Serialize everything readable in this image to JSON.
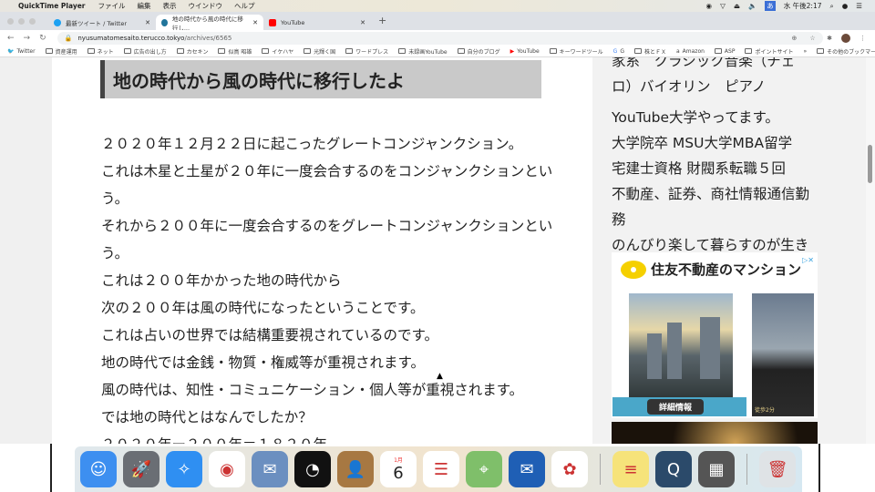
{
  "menubar": {
    "app": "QuickTime Player",
    "items": [
      "ファイル",
      "編集",
      "表示",
      "ウインドウ",
      "ヘルプ"
    ],
    "clock": "水 午後2:17",
    "input_mode": "あ"
  },
  "tabs": [
    {
      "title": "最新ツイート / Twitter",
      "color": "#1da1f2"
    },
    {
      "title": "地の時代から風の時代に移行し...",
      "color": "#21759b",
      "active": true
    },
    {
      "title": "YouTube",
      "color": "#ff0000"
    }
  ],
  "address": {
    "host": "nyusumatomesaito.terucco.tokyo",
    "path": "/archives/6565"
  },
  "bookmarks": [
    "Twitter",
    "資産運用",
    "ネット",
    "広告の出し方",
    "カセキン",
    "似鳥 昭雄",
    "イケハヤ",
    "光輝く国",
    "ワードプレス",
    "未録画YouTube",
    "自分のブログ",
    "YouTube",
    "キーワードツール",
    "G",
    "株とＦＸ",
    "Amazon",
    "ASP",
    "ポイントサイト"
  ],
  "bookmarks_more": "»",
  "bookmarks_other": "その他のブックマーク",
  "article": {
    "heading": "地の時代から風の時代に移行したよ",
    "lines": [
      "２０２０年１２月２２日に起こったグレートコンジャンクション。",
      "これは木星と土星が２０年に一度会合するのをコンジャンクションとい",
      "う。",
      "それから２００年に一度会合するのをグレートコンジャンクションとい",
      "う。",
      "これは２００年かかった地の時代から",
      "次の２００年は風の時代になったということです。",
      "これは占いの世界では結構重要視されているのです。",
      "地の時代では金銭・物質・権威等が重視されます。",
      "風の時代は、知性・コミュニケーション・個人等が重視されます。",
      "では地の時代とはなんでしたか？",
      "２０２０年ー２００年＝１８２０年"
    ]
  },
  "sidebar": {
    "profile_lines": [
      "家系　クラシック音楽（チェ",
      "ロ）バイオリン　ピアノ",
      "YouTube大学やってます。",
      "大学院卒 MSU大学MBA留学",
      "宅建士資格 財閥系転職５回",
      "不動産、証券、商社情報通信勤務",
      "のんびり楽して暮らすのが生きる",
      "哲学です。楽しく行きましょう。"
    ],
    "ad": {
      "brand": "住友不動産のマンション",
      "button": "詳細情報",
      "caption": "徒歩2分"
    }
  },
  "scroll_position": 0.3,
  "dock": {
    "calendar_month": "1月",
    "calendar_day": "6",
    "apps": [
      "Finder",
      "Launchpad",
      "Safari",
      "Chrome",
      "Mail",
      "Dashboard",
      "Contacts",
      "Calendar",
      "Reminders",
      "Maps",
      "Thunderbird",
      "Photos",
      "Notes",
      "QuickTime Player",
      "Calculator",
      "Trash"
    ]
  }
}
